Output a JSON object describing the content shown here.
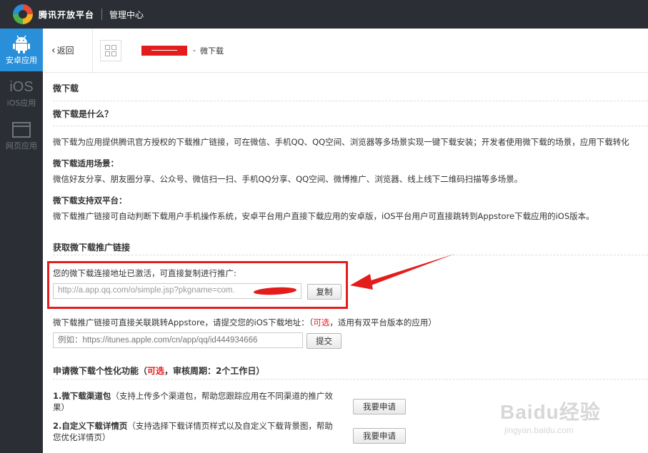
{
  "topbar": {
    "brand": "腾讯开放平台",
    "section": "管理中心"
  },
  "nav": [
    {
      "label": "安卓应用",
      "icon": "android-icon",
      "active": true
    },
    {
      "label": "iOS应用",
      "icon": "ios-icon",
      "active": false
    },
    {
      "label": "网页应用",
      "icon": "web-icon",
      "active": false
    }
  ],
  "ios_glyph": "iOS",
  "header": {
    "back": "返回",
    "dash": "-",
    "crumb": "微下载"
  },
  "main": {
    "title": "微下载",
    "what_title": "微下载是什么？",
    "what_text": "微下载为应用提供腾讯官方授权的下载推广链接，可在微信、手机QQ、QQ空间、浏览器等多场景实现一键下载安装；开发者使用微下载的场景，应用下载转化",
    "scene_title": "微下载适用场景：",
    "scene_text": "微信好友分享、朋友圈分享、公众号、微信扫一扫、手机QQ分享、QQ空间、微博推广、浏览器、线上线下二维码扫描等多场景。",
    "platform_title": "微下载支持双平台：",
    "platform_text": "微下载推广链接可自动判断下载用户手机操作系统，安卓平台用户直接下载应用的安卓版，iOS平台用户可直接跳转到Appstore下载应用的iOS版本。",
    "get_title": "获取微下载推广链接",
    "activated_text": "您的微下载连接地址已激活，可直接复制进行推广:",
    "url_value": "http://a.app.qq.com/o/simple.jsp?pkgname=com.",
    "copy_button": "复制",
    "ios_text_prefix": "微下载推广链接可直接关联跳转Appstore，请提交您的iOS下载地址：（",
    "optional": "可选",
    "ios_text_suffix": "，适用有双平台版本的应用）",
    "ios_placeholder": "例如：https://itunes.apple.com/cn/app/qq/id444934666",
    "submit_button": "提交",
    "custom_title_prefix": "申请微下载个性化功能（",
    "custom_title_optional": "可选",
    "custom_title_suffix": "，审核周期：2个工作日）",
    "item1_bold": "1.微下载渠道包",
    "item1_text": "（支持上传多个渠道包，帮助您跟踪应用在不同渠道的推广效",
    "item1_text2": "果）",
    "item1_button": "我要申请",
    "item2_bold": "2.自定义下载详情页",
    "item2_text": "（支持选择下载详情页样式以及自定义下载背景图，帮助",
    "item2_text2": "您优化详情页）",
    "item2_button": "我要申请"
  },
  "watermark": {
    "big": "Baidu经验",
    "small": "jingyan.baidu.com"
  },
  "colors": {
    "accent": "#2a8fd9",
    "highlight": "#e31c1c",
    "dark": "#2b2f35"
  }
}
